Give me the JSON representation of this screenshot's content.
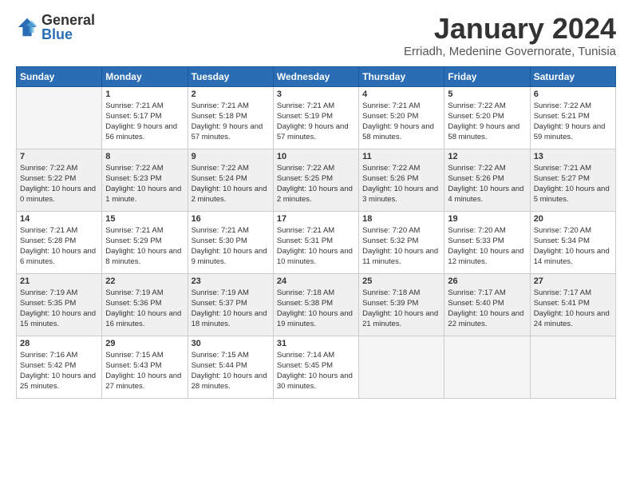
{
  "logo": {
    "general": "General",
    "blue": "Blue"
  },
  "header": {
    "month_year": "January 2024",
    "location": "Erriadh, Medenine Governorate, Tunisia"
  },
  "columns": [
    "Sunday",
    "Monday",
    "Tuesday",
    "Wednesday",
    "Thursday",
    "Friday",
    "Saturday"
  ],
  "weeks": [
    [
      {
        "day": "",
        "sunrise": "",
        "sunset": "",
        "daylight": ""
      },
      {
        "day": "1",
        "sunrise": "7:21 AM",
        "sunset": "5:17 PM",
        "daylight": "9 hours and 56 minutes."
      },
      {
        "day": "2",
        "sunrise": "7:21 AM",
        "sunset": "5:18 PM",
        "daylight": "9 hours and 57 minutes."
      },
      {
        "day": "3",
        "sunrise": "7:21 AM",
        "sunset": "5:19 PM",
        "daylight": "9 hours and 57 minutes."
      },
      {
        "day": "4",
        "sunrise": "7:21 AM",
        "sunset": "5:20 PM",
        "daylight": "9 hours and 58 minutes."
      },
      {
        "day": "5",
        "sunrise": "7:22 AM",
        "sunset": "5:20 PM",
        "daylight": "9 hours and 58 minutes."
      },
      {
        "day": "6",
        "sunrise": "7:22 AM",
        "sunset": "5:21 PM",
        "daylight": "9 hours and 59 minutes."
      }
    ],
    [
      {
        "day": "7",
        "sunrise": "7:22 AM",
        "sunset": "5:22 PM",
        "daylight": "10 hours and 0 minutes."
      },
      {
        "day": "8",
        "sunrise": "7:22 AM",
        "sunset": "5:23 PM",
        "daylight": "10 hours and 1 minute."
      },
      {
        "day": "9",
        "sunrise": "7:22 AM",
        "sunset": "5:24 PM",
        "daylight": "10 hours and 2 minutes."
      },
      {
        "day": "10",
        "sunrise": "7:22 AM",
        "sunset": "5:25 PM",
        "daylight": "10 hours and 2 minutes."
      },
      {
        "day": "11",
        "sunrise": "7:22 AM",
        "sunset": "5:26 PM",
        "daylight": "10 hours and 3 minutes."
      },
      {
        "day": "12",
        "sunrise": "7:22 AM",
        "sunset": "5:26 PM",
        "daylight": "10 hours and 4 minutes."
      },
      {
        "day": "13",
        "sunrise": "7:21 AM",
        "sunset": "5:27 PM",
        "daylight": "10 hours and 5 minutes."
      }
    ],
    [
      {
        "day": "14",
        "sunrise": "7:21 AM",
        "sunset": "5:28 PM",
        "daylight": "10 hours and 6 minutes."
      },
      {
        "day": "15",
        "sunrise": "7:21 AM",
        "sunset": "5:29 PM",
        "daylight": "10 hours and 8 minutes."
      },
      {
        "day": "16",
        "sunrise": "7:21 AM",
        "sunset": "5:30 PM",
        "daylight": "10 hours and 9 minutes."
      },
      {
        "day": "17",
        "sunrise": "7:21 AM",
        "sunset": "5:31 PM",
        "daylight": "10 hours and 10 minutes."
      },
      {
        "day": "18",
        "sunrise": "7:20 AM",
        "sunset": "5:32 PM",
        "daylight": "10 hours and 11 minutes."
      },
      {
        "day": "19",
        "sunrise": "7:20 AM",
        "sunset": "5:33 PM",
        "daylight": "10 hours and 12 minutes."
      },
      {
        "day": "20",
        "sunrise": "7:20 AM",
        "sunset": "5:34 PM",
        "daylight": "10 hours and 14 minutes."
      }
    ],
    [
      {
        "day": "21",
        "sunrise": "7:19 AM",
        "sunset": "5:35 PM",
        "daylight": "10 hours and 15 minutes."
      },
      {
        "day": "22",
        "sunrise": "7:19 AM",
        "sunset": "5:36 PM",
        "daylight": "10 hours and 16 minutes."
      },
      {
        "day": "23",
        "sunrise": "7:19 AM",
        "sunset": "5:37 PM",
        "daylight": "10 hours and 18 minutes."
      },
      {
        "day": "24",
        "sunrise": "7:18 AM",
        "sunset": "5:38 PM",
        "daylight": "10 hours and 19 minutes."
      },
      {
        "day": "25",
        "sunrise": "7:18 AM",
        "sunset": "5:39 PM",
        "daylight": "10 hours and 21 minutes."
      },
      {
        "day": "26",
        "sunrise": "7:17 AM",
        "sunset": "5:40 PM",
        "daylight": "10 hours and 22 minutes."
      },
      {
        "day": "27",
        "sunrise": "7:17 AM",
        "sunset": "5:41 PM",
        "daylight": "10 hours and 24 minutes."
      }
    ],
    [
      {
        "day": "28",
        "sunrise": "7:16 AM",
        "sunset": "5:42 PM",
        "daylight": "10 hours and 25 minutes."
      },
      {
        "day": "29",
        "sunrise": "7:15 AM",
        "sunset": "5:43 PM",
        "daylight": "10 hours and 27 minutes."
      },
      {
        "day": "30",
        "sunrise": "7:15 AM",
        "sunset": "5:44 PM",
        "daylight": "10 hours and 28 minutes."
      },
      {
        "day": "31",
        "sunrise": "7:14 AM",
        "sunset": "5:45 PM",
        "daylight": "10 hours and 30 minutes."
      },
      {
        "day": "",
        "sunrise": "",
        "sunset": "",
        "daylight": ""
      },
      {
        "day": "",
        "sunrise": "",
        "sunset": "",
        "daylight": ""
      },
      {
        "day": "",
        "sunrise": "",
        "sunset": "",
        "daylight": ""
      }
    ]
  ],
  "labels": {
    "sunrise_prefix": "Sunrise: ",
    "sunset_prefix": "Sunset: ",
    "daylight_prefix": "Daylight: "
  }
}
